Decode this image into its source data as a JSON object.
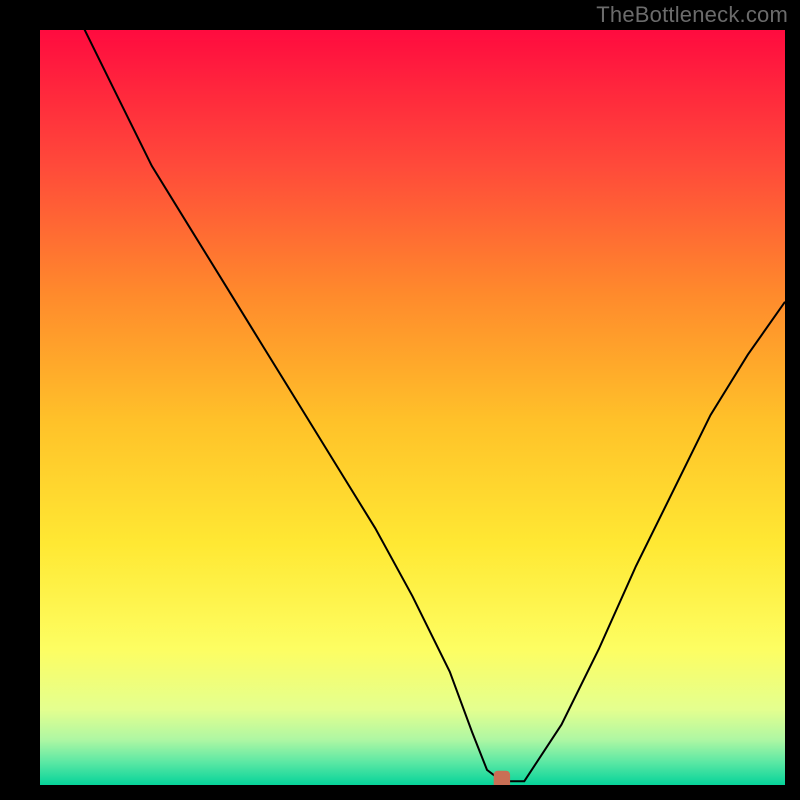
{
  "watermark": "TheBottleneck.com",
  "chart_data": {
    "type": "line",
    "title": "",
    "xlabel": "",
    "ylabel": "",
    "xlim": [
      0,
      100
    ],
    "ylim": [
      0,
      100
    ],
    "grid": false,
    "background": "rainbow-vertical-gradient",
    "gradient_stops": [
      {
        "pos": 0,
        "color": "#ff0b3f"
      },
      {
        "pos": 18,
        "color": "#ff4a3a"
      },
      {
        "pos": 35,
        "color": "#ff8a2c"
      },
      {
        "pos": 52,
        "color": "#ffc229"
      },
      {
        "pos": 68,
        "color": "#ffe833"
      },
      {
        "pos": 82,
        "color": "#fdfe62"
      },
      {
        "pos": 90,
        "color": "#e4ff8f"
      },
      {
        "pos": 94,
        "color": "#aef7a3"
      },
      {
        "pos": 97,
        "color": "#5be8a4"
      },
      {
        "pos": 100,
        "color": "#06d39a"
      }
    ],
    "series": [
      {
        "name": "curve",
        "color": "#000000",
        "stroke_width": 2,
        "x": [
          5,
          10,
          15,
          20,
          25,
          30,
          35,
          40,
          45,
          50,
          55,
          58,
          60,
          62,
          65,
          70,
          75,
          80,
          85,
          90,
          95,
          100
        ],
        "y": [
          102,
          92,
          82,
          74,
          66,
          58,
          50,
          42,
          34,
          25,
          15,
          7,
          2,
          0.5,
          0.5,
          8,
          18,
          29,
          39,
          49,
          57,
          64
        ]
      }
    ],
    "marker": {
      "name": "target-point",
      "color": "#c96f55",
      "shape": "rounded-rect",
      "x": 62,
      "y": 0.5,
      "w": 2.2,
      "h": 2.8
    }
  }
}
